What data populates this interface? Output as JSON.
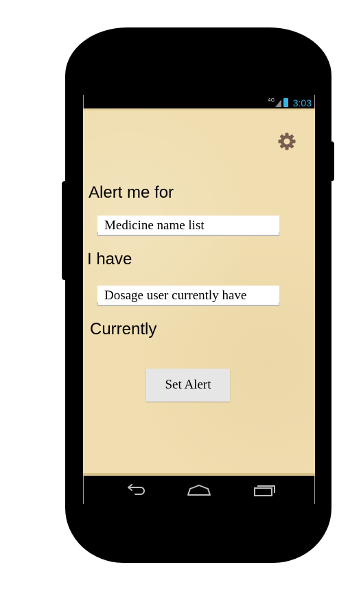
{
  "status_bar": {
    "network": "4G",
    "time": "3:03"
  },
  "screen": {
    "settings_icon": "gear-icon",
    "alert_label": "Alert me for",
    "medicine_field": {
      "value": "Medicine name list"
    },
    "have_label": "I have",
    "dosage_field": {
      "value": "Dosage user currently have"
    },
    "currently_label": "Currently",
    "set_alert_label": "Set Alert"
  },
  "nav_bar": {
    "icons": [
      "back-icon",
      "home-icon",
      "recent-apps-icon"
    ]
  },
  "colors": {
    "screen_background": "#f0deb0",
    "status_accent": "#33b5e5",
    "gear": "#7a5c50",
    "button": "#e6e6e6"
  }
}
